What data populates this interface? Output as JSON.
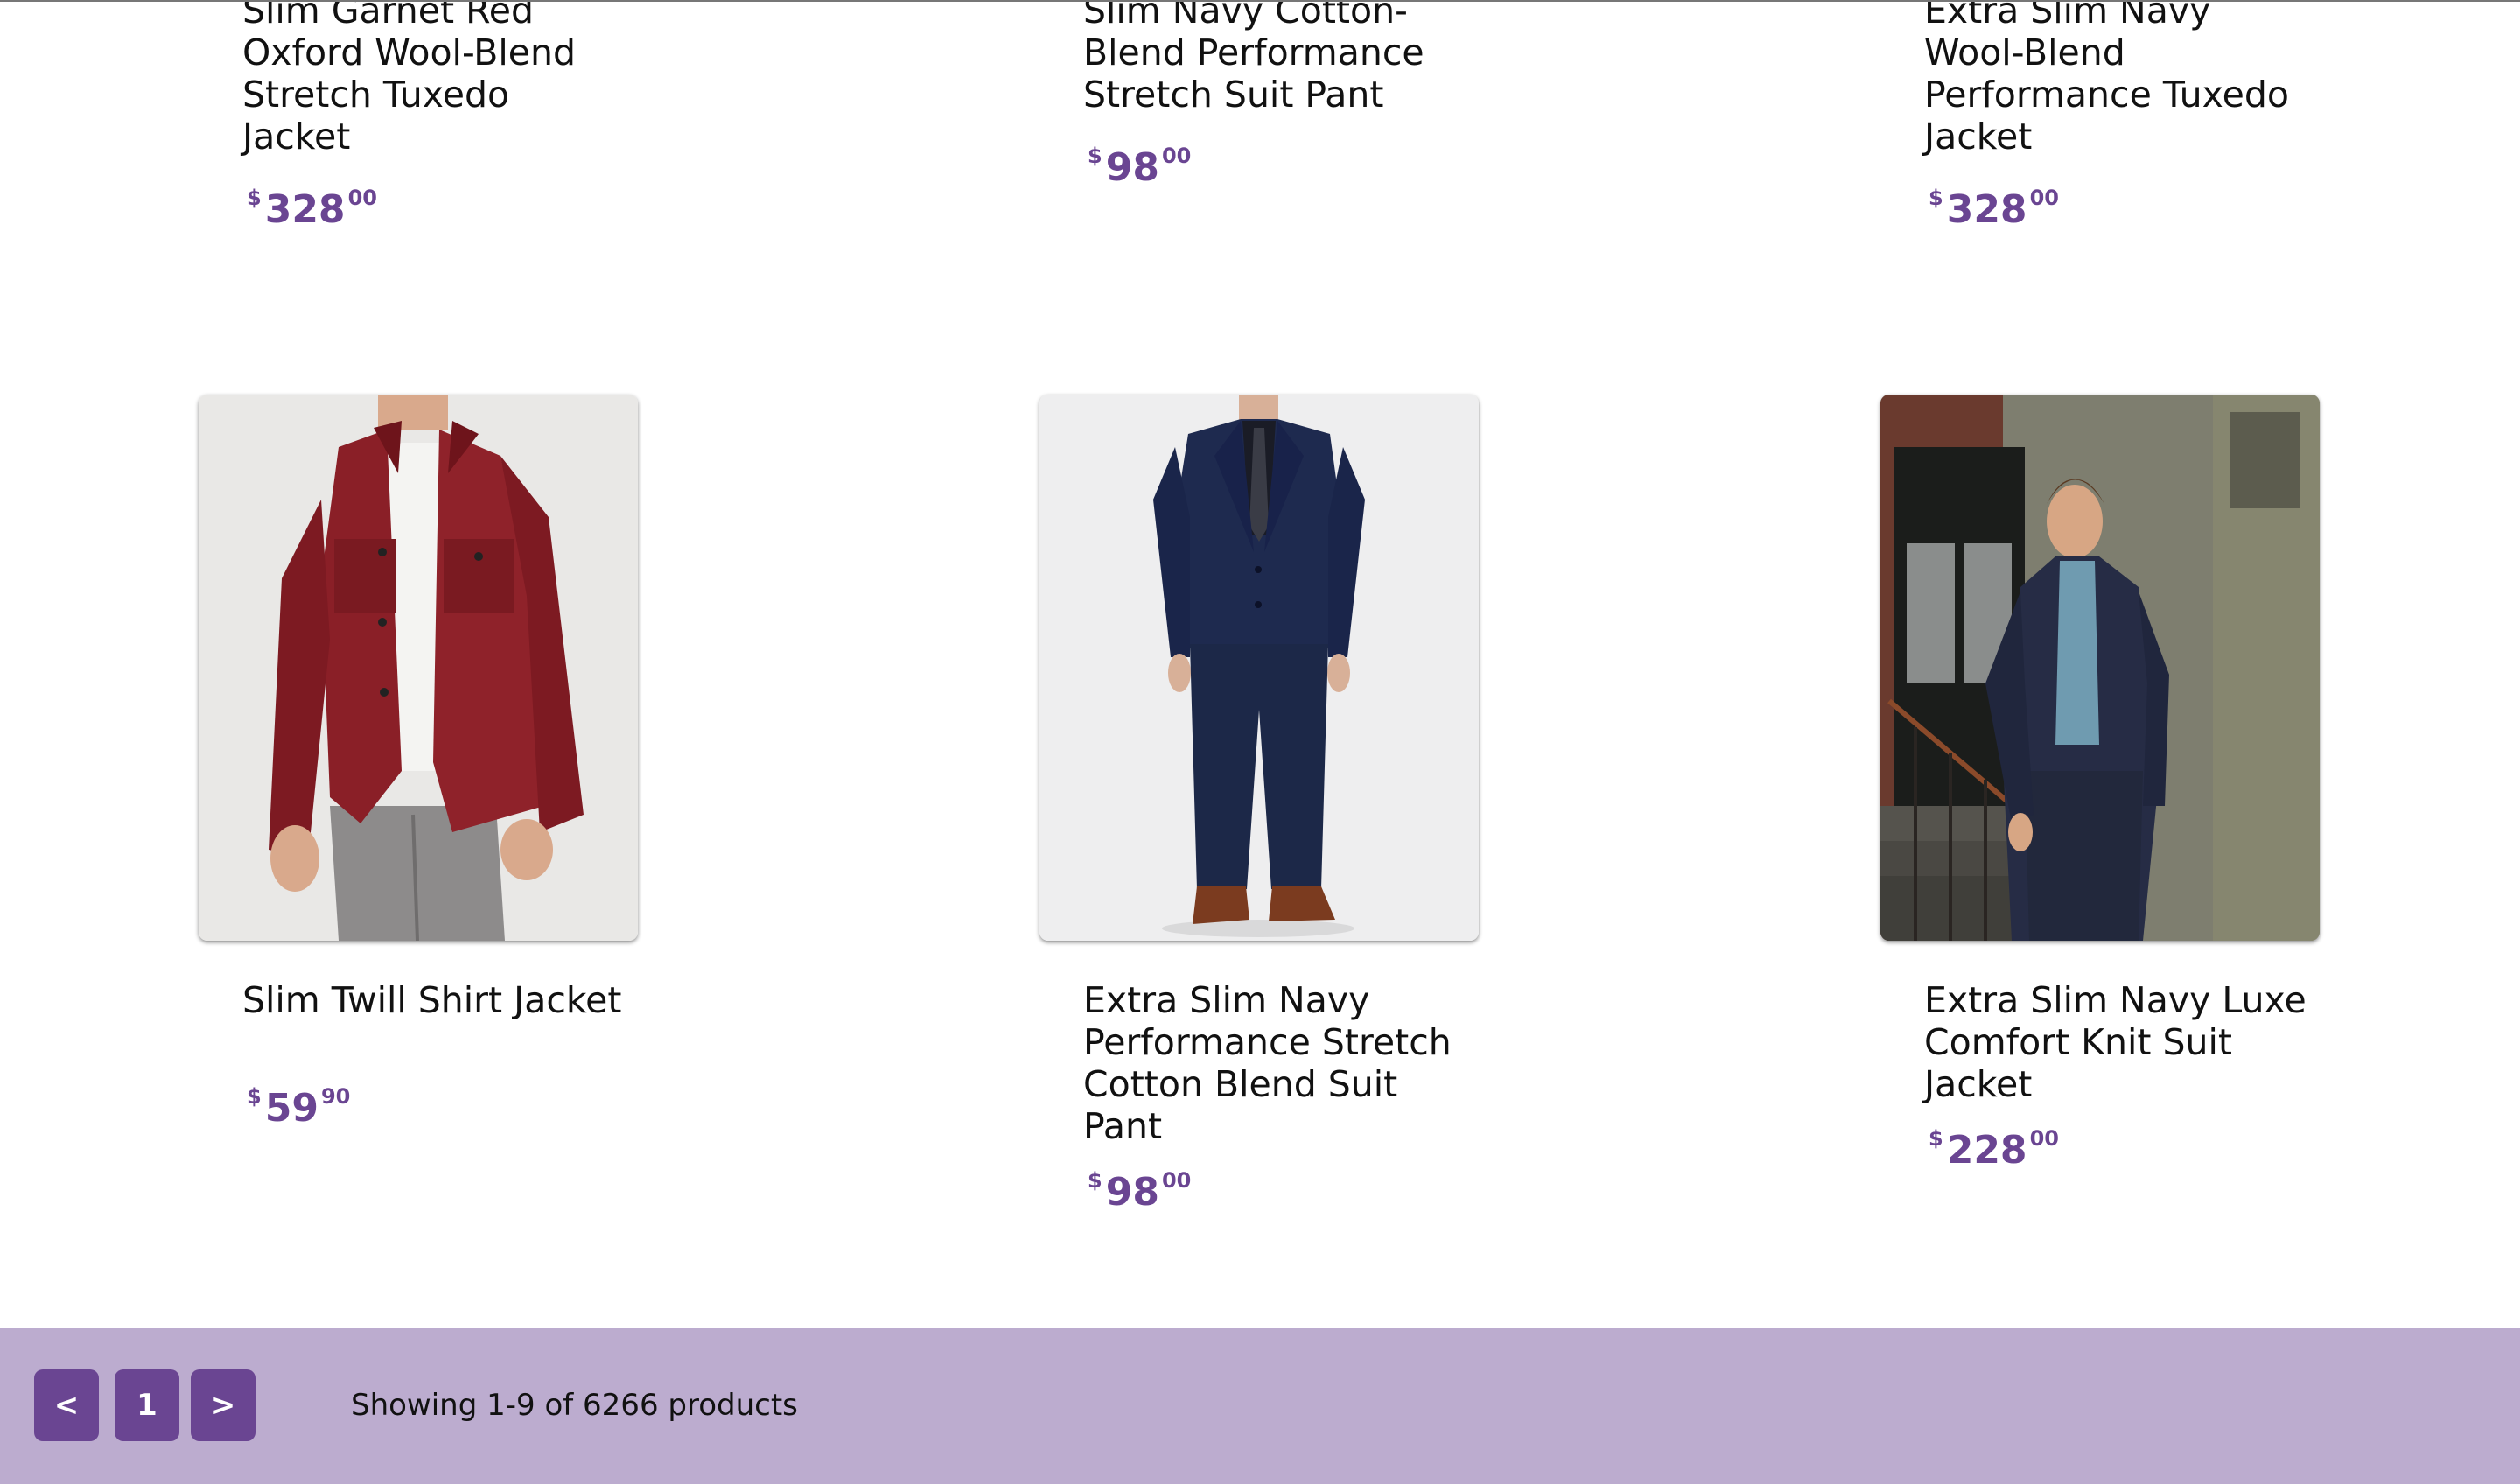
{
  "products": [
    {
      "title": "Slim Garnet Red Oxford Wool-Blend Stretch Tuxedo Jacket",
      "price": {
        "currency": "$",
        "main": "328",
        "cents": "00"
      }
    },
    {
      "title": "Slim Navy Cotton-Blend Performance Stretch Suit Pant",
      "price": {
        "currency": "$",
        "main": "98",
        "cents": "00"
      }
    },
    {
      "title": "Extra Slim Navy Wool-Blend Performance Tuxedo Jacket",
      "price": {
        "currency": "$",
        "main": "328",
        "cents": "00"
      }
    },
    {
      "title": "Slim Twill Shirt Jacket",
      "price": {
        "currency": "$",
        "main": "59",
        "cents": "90"
      },
      "image": "red-twill-shirt-jacket-photo"
    },
    {
      "title": "Extra Slim Navy Performance Stretch Cotton Blend Suit Pant",
      "price": {
        "currency": "$",
        "main": "98",
        "cents": "00"
      },
      "image": "navy-suit-full-length-photo"
    },
    {
      "title": "Extra Slim Navy Luxe Comfort Knit Suit Jacket",
      "price": {
        "currency": "$",
        "main": "228",
        "cents": "00"
      },
      "image": "navy-knit-jacket-street-photo"
    }
  ],
  "pagination": {
    "prev_label": "<",
    "page_label": "1",
    "next_label": ">",
    "status_text": "Showing 1-9 of 6266 products"
  },
  "colors": {
    "accent": "#6a4592",
    "footer_background": "#bcaccf"
  }
}
